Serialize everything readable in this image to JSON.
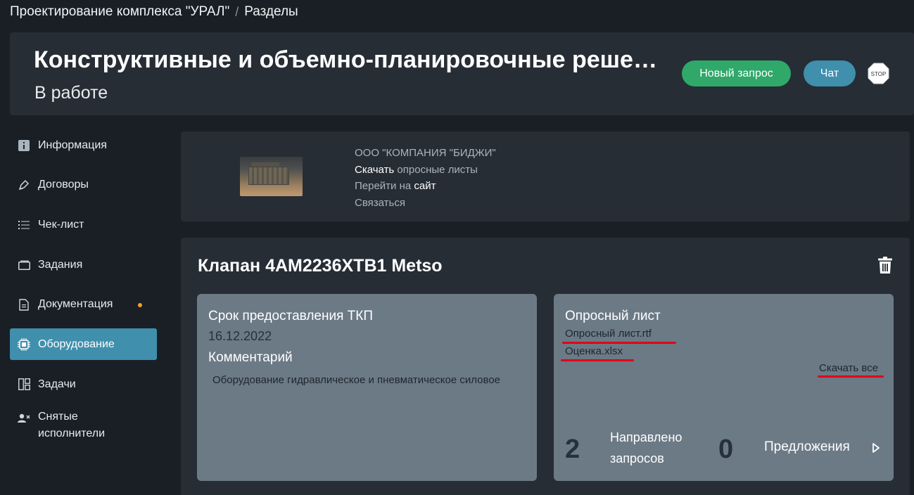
{
  "breadcrumb": {
    "project": "Проектирование комплекса \"УРАЛ\"",
    "separator": "/",
    "current": "Разделы"
  },
  "header": {
    "title": "Конструктивные и объемно-планировочные решения",
    "status": "В работе",
    "new_request_label": "Новый запрос",
    "chat_label": "Чат",
    "stop_label": "STOP"
  },
  "sidebar": {
    "items": [
      {
        "label": "Информация",
        "icon": "info-icon"
      },
      {
        "label": "Договоры",
        "icon": "pen-icon"
      },
      {
        "label": "Чек-лист",
        "icon": "checklist-icon"
      },
      {
        "label": "Задания",
        "icon": "tasks-folder-icon"
      },
      {
        "label": "Документация",
        "icon": "document-icon"
      },
      {
        "label": "Оборудование",
        "icon": "chip-icon",
        "active": true
      },
      {
        "label": "Задачи",
        "icon": "dashboard-icon"
      },
      {
        "label": "Снятые исполнители",
        "icon": "user-remove-icon"
      }
    ],
    "accent_dot_color": "#f0a030"
  },
  "company": {
    "name": "ООО \"КОМПАНИЯ \"БИДЖИ\"",
    "download_word": "Скачать",
    "download_rest": " опросные листы",
    "goto_prefix": "Перейти на ",
    "goto_site": "сайт",
    "contact": "Связаться"
  },
  "equipment": {
    "title": "Клапан 4AM2236XTB1 Metso",
    "deadline_label": "Срок предоставления ТКП",
    "deadline_value": "16.12.2022",
    "comment_label": "Комментарий",
    "comment_value": "Оборудование гидравлическое и пневматическое силовое",
    "questionnaire_label": "Опросный лист",
    "files": [
      "Опросный лист.rtf",
      "Оценка.xlsx"
    ],
    "download_all": "Скачать все",
    "sent_count": "2",
    "sent_label_line1": "Направлено",
    "sent_label_line2": "запросов",
    "offers_count": "0",
    "offers_label": "Предложения"
  },
  "colors": {
    "bg": "#1a1f26",
    "panel": "#262d35",
    "accent_green": "#2fa86a",
    "accent_blue": "#3f8fad",
    "subcard": "#6c7a86",
    "highlight_red": "#e0001a"
  }
}
